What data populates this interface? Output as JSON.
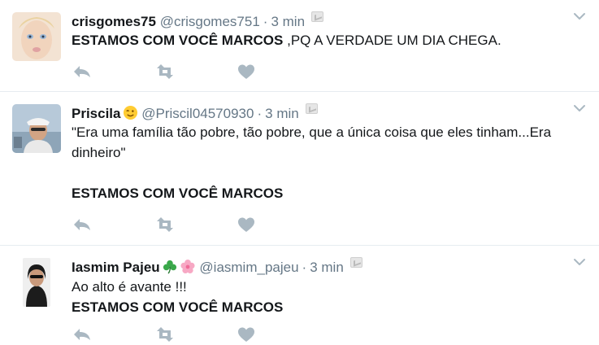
{
  "tweets": [
    {
      "name": "crisgomes75",
      "handle": "@crisgomes751",
      "separator": "·",
      "time": "3 min",
      "body_bold": "ESTAMOS COM VOCÊ MARCOS",
      "body_rest": " ,PQ A VERDADE UM DIA CHEGA."
    },
    {
      "name": "Priscila",
      "emoji": "wink-emoji",
      "handle": "@Priscil04570930",
      "separator": "·",
      "time": "3 min",
      "body_line1": "\"Era uma família tão pobre, tão pobre, que a única coisa que eles tinham...Era",
      "body_line2": "dinheiro\"",
      "body_bold": "ESTAMOS COM VOCÊ MARCOS"
    },
    {
      "name": "Iasmim Pajeu",
      "emojis": [
        "shamrock-emoji",
        "cherry-blossom-emoji"
      ],
      "handle": "@iasmim_pajeu",
      "separator": "·",
      "time": "3 min",
      "body_line1": "Ao alto é avante !!!",
      "body_bold": "ESTAMOS COM VOCÊ MARCOS"
    }
  ],
  "icons": {
    "reply": "reply-icon",
    "retweet": "retweet-icon",
    "like": "heart-icon",
    "menu": "chevron-down-icon"
  },
  "colors": {
    "icon_gray": "#aab8c2",
    "text_secondary": "#657786",
    "divider": "#e6ecf0"
  }
}
